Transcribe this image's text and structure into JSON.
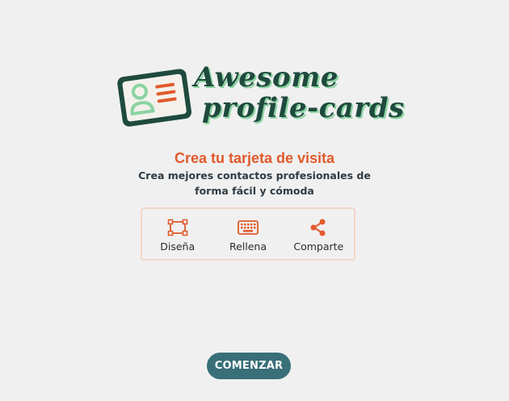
{
  "logo": {
    "line1": "Awesome",
    "line2": "profile-cards",
    "icon": "id-card-icon"
  },
  "hero": {
    "title": "Crea tu tarjeta de visita",
    "subtitle": "Crea mejores contactos profesionales de forma fácil y cómoda"
  },
  "steps": [
    {
      "label": "Diseña",
      "icon": "design-icon"
    },
    {
      "label": "Rellena",
      "icon": "keyboard-icon"
    },
    {
      "label": "Comparte",
      "icon": "share-icon"
    }
  ],
  "cta": {
    "label": "COMENZAR"
  },
  "colors": {
    "background": "#f0f0f0",
    "accent": "#e05a2b",
    "brand_dark": "#1f4a3e",
    "brand_light": "#8ad3a0",
    "button": "#386f78",
    "steps_border": "#f3d6c9"
  }
}
